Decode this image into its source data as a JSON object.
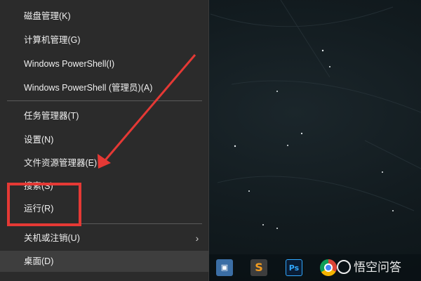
{
  "menu": {
    "items": [
      {
        "label": "磁盘管理(K)"
      },
      {
        "label": "计算机管理(G)"
      },
      {
        "label": "Windows PowerShell(I)"
      },
      {
        "label": "Windows PowerShell (管理员)(A)"
      },
      {
        "label": "任务管理器(T)"
      },
      {
        "label": "设置(N)"
      },
      {
        "label": "文件资源管理器(E)"
      },
      {
        "label": "搜索(S)"
      },
      {
        "label": "运行(R)"
      },
      {
        "label": "关机或注销(U)",
        "submenu_icon": "chevron-right-icon"
      },
      {
        "label": "桌面(D)"
      }
    ]
  },
  "annotation": {
    "color": "#e53935"
  },
  "taskbar": {
    "icons": [
      "this-pc-icon",
      "sublime-text-icon",
      "photoshop-icon",
      "chrome-icon"
    ],
    "ps_label": "Ps",
    "sub_label": "S"
  },
  "watermark": {
    "text": "悟空问答"
  }
}
